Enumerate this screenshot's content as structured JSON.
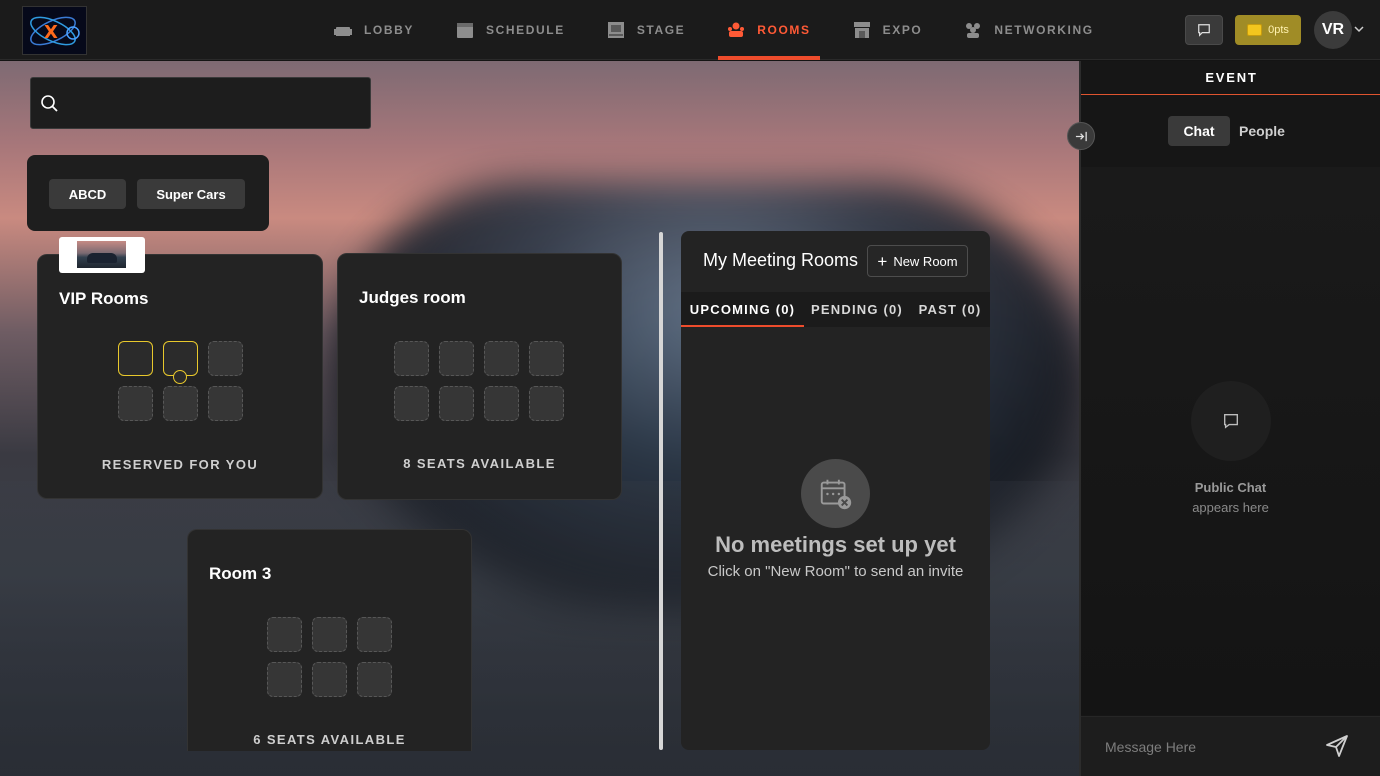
{
  "nav": {
    "items": [
      {
        "label": "LOBBY",
        "icon": "sofa-icon",
        "active": false
      },
      {
        "label": "SCHEDULE",
        "icon": "calendar-icon",
        "active": false
      },
      {
        "label": "STAGE",
        "icon": "stage-icon",
        "active": false
      },
      {
        "label": "ROOMS",
        "icon": "rooms-icon",
        "active": true
      },
      {
        "label": "EXPO",
        "icon": "booth-icon",
        "active": false
      },
      {
        "label": "NETWORKING",
        "icon": "people-icon",
        "active": false
      }
    ],
    "accent_color": "#ee4c2c"
  },
  "header": {
    "points_label": "0pts",
    "avatar_initials": "VR"
  },
  "search": {
    "placeholder": "",
    "value": ""
  },
  "filters": [
    "ABCD",
    "Super Cars"
  ],
  "rooms": [
    {
      "title": "VIP Rooms",
      "status": "RESERVED FOR YOU",
      "seats_total": 6,
      "reserved_seats": 2
    },
    {
      "title": "Judges room",
      "status": "8 SEATS AVAILABLE",
      "seats_total": 8,
      "reserved_seats": 0
    },
    {
      "title": "Room 3",
      "status": "6 SEATS AVAILABLE",
      "seats_total": 6,
      "reserved_seats": 0
    }
  ],
  "meetings": {
    "title": "My Meeting Rooms",
    "new_room_label": "New Room",
    "tabs": [
      "UPCOMING (0)",
      "PENDING (0)",
      "PAST (0)"
    ],
    "active_tab": 0,
    "empty_title": "No meetings set up yet",
    "empty_sub": "Click on \"New Room\" to send an invite"
  },
  "sidebar": {
    "header": "EVENT",
    "tabs": [
      "Chat",
      "People"
    ],
    "active_tab": "Chat",
    "empty_title": "Public Chat",
    "empty_sub": "appears here",
    "message_placeholder": "Message Here"
  }
}
